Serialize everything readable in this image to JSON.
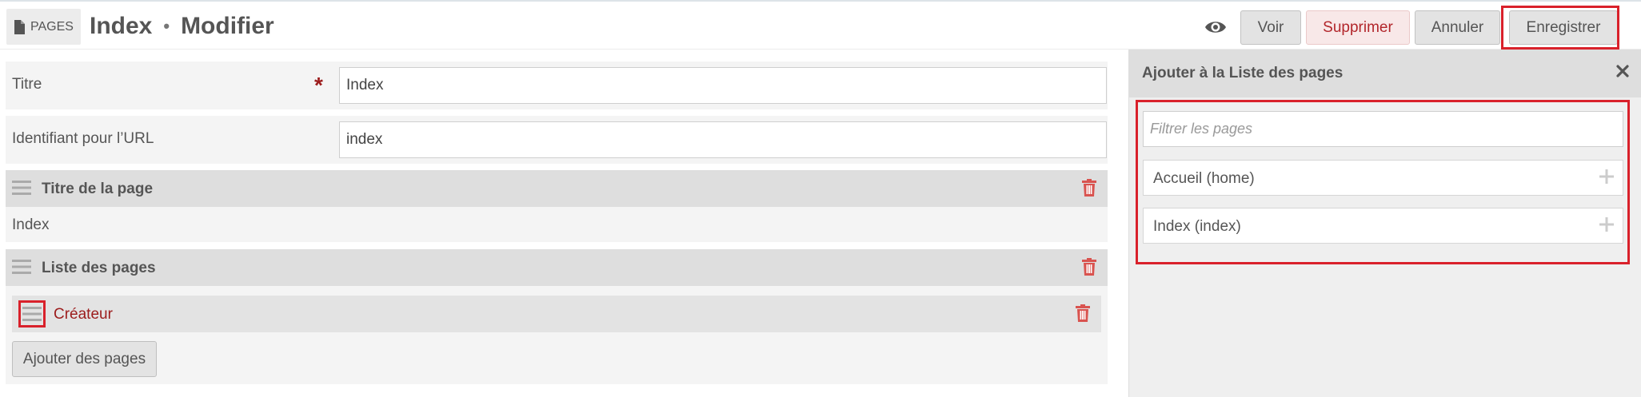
{
  "header": {
    "section_label": "PAGES",
    "page_name": "Index",
    "separator": "•",
    "mode": "Modifier",
    "actions": {
      "view": "Voir",
      "delete": "Supprimer",
      "cancel": "Annuler",
      "save": "Enregistrer"
    }
  },
  "form": {
    "title_field": {
      "label": "Titre",
      "required_mark": "*",
      "value": "Index"
    },
    "url_field": {
      "label": "Identifiant pour l’URL",
      "value": "index"
    }
  },
  "blocks": [
    {
      "title": "Titre de la page",
      "value": "Index"
    },
    {
      "title": "Liste des pages",
      "items": [
        {
          "name": "Créateur"
        }
      ],
      "add_label": "Ajouter des pages"
    }
  ],
  "side_panel": {
    "title": "Ajouter à la Liste des pages",
    "filter_placeholder": "Filtrer les pages",
    "pages": [
      {
        "label": "Accueil (home)"
      },
      {
        "label": "Index (index)"
      }
    ]
  },
  "colors": {
    "danger": "#b2262b",
    "accent_dark_red": "#9c1c1c",
    "highlight": "#d9212b"
  },
  "icons": [
    "file-icon",
    "eye-icon",
    "drag-handle-icon",
    "trash-icon",
    "close-icon",
    "plus-icon"
  ]
}
